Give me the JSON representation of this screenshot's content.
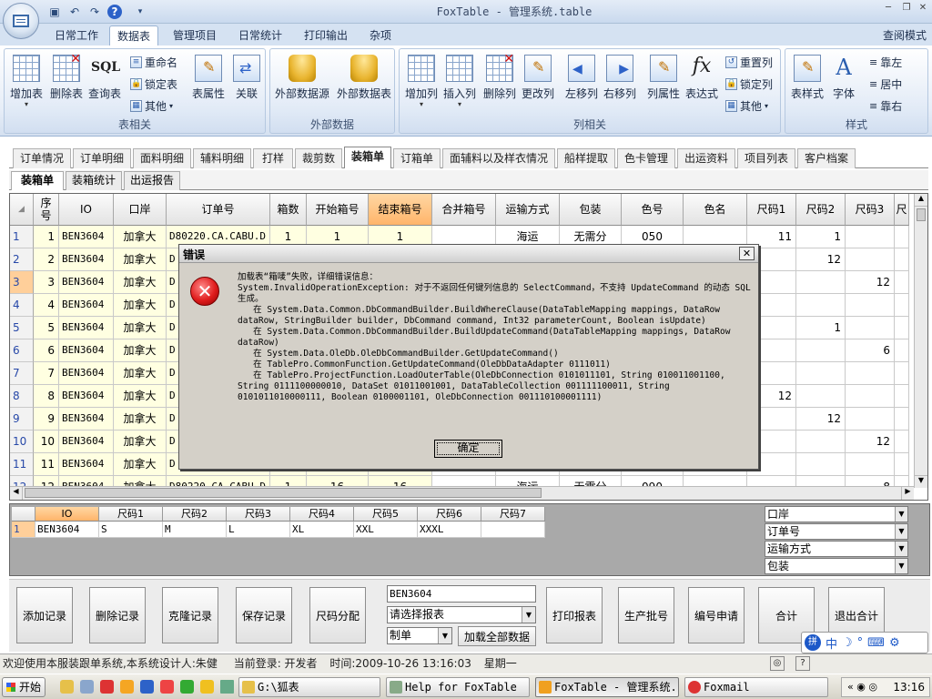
{
  "window": {
    "title": "FoxTable - 管理系统.table"
  },
  "ribbon_tabs": [
    {
      "label": "日常工作",
      "active": false
    },
    {
      "label": "数据表",
      "active": true
    },
    {
      "label": "管理项目",
      "active": false
    },
    {
      "label": "日常统计",
      "active": false
    },
    {
      "label": "打印输出",
      "active": false
    },
    {
      "label": "杂项",
      "active": false
    }
  ],
  "view_mode": "查阅模式",
  "ribbon_groups": {
    "table": {
      "label": "表相关",
      "buttons": [
        "增加表",
        "删除表",
        "查询表"
      ],
      "small": [
        "重命名",
        "锁定表",
        "其他"
      ],
      "extra": [
        "表属性",
        "关联"
      ]
    },
    "external": {
      "label": "外部数据",
      "buttons": [
        "外部数据源",
        "外部数据表"
      ]
    },
    "column": {
      "label": "列相关",
      "buttons": [
        "增加列",
        "插入列",
        "删除列",
        "更改列",
        "左移列",
        "右移列",
        "列属性",
        "表达式"
      ],
      "small": [
        "重置列",
        "锁定列",
        "其他"
      ]
    },
    "style": {
      "label": "样式",
      "buttons": [
        "表样式",
        "字体"
      ],
      "small": [
        "靠左",
        "居中",
        "靠右"
      ]
    },
    "sql_icon": "SQL"
  },
  "main_tabs": [
    {
      "label": "订单情况",
      "active": false
    },
    {
      "label": "订单明细",
      "active": false
    },
    {
      "label": "面料明细",
      "active": false
    },
    {
      "label": "辅料明细",
      "active": false
    },
    {
      "label": "打样",
      "active": false
    },
    {
      "label": "裁剪数",
      "active": false
    },
    {
      "label": "装箱单",
      "active": true
    },
    {
      "label": "订箱单",
      "active": false
    },
    {
      "label": "面辅料以及样衣情况",
      "active": false
    },
    {
      "label": "船样提取",
      "active": false
    },
    {
      "label": "色卡管理",
      "active": false
    },
    {
      "label": "出运资料",
      "active": false
    },
    {
      "label": "项目列表",
      "active": false
    },
    {
      "label": "客户档案",
      "active": false
    }
  ],
  "sub_tabs": [
    {
      "label": "装箱单",
      "active": true
    },
    {
      "label": "装箱统计",
      "active": false
    },
    {
      "label": "出运报告",
      "active": false
    }
  ],
  "grid": {
    "columns": [
      "序\n号",
      "IO",
      "口岸",
      "订单号",
      "箱数",
      "开始箱号",
      "结束箱号",
      "合并箱号",
      "运输方式",
      "包装",
      "色号",
      "色名",
      "尺码1",
      "尺码2",
      "尺码3",
      "尺"
    ],
    "rows": [
      {
        "rn": "1",
        "seq": "1",
        "io": "BEN3604",
        "port": "加拿大",
        "order": "D80220.CA.CABU.D",
        "boxes": "1",
        "start": "1",
        "end": "1",
        "transport": "海运",
        "pack": "无需分",
        "color": "050",
        "s1": "11",
        "s2": "1",
        "s3": ""
      },
      {
        "rn": "2",
        "seq": "2",
        "io": "BEN3604",
        "port": "加拿大",
        "order": "D",
        "s2": "12",
        "s1": "",
        "s3": ""
      },
      {
        "rn": "3",
        "seq": "3",
        "io": "BEN3604",
        "port": "加拿大",
        "order": "D",
        "s1": "",
        "s2": "",
        "s3": "12"
      },
      {
        "rn": "4",
        "seq": "4",
        "io": "BEN3604",
        "port": "加拿大",
        "order": "D",
        "s1": "",
        "s2": "",
        "s3": ""
      },
      {
        "rn": "5",
        "seq": "5",
        "io": "BEN3604",
        "port": "加拿大",
        "order": "D",
        "s1": "",
        "s2": "1",
        "s3": ""
      },
      {
        "rn": "6",
        "seq": "6",
        "io": "BEN3604",
        "port": "加拿大",
        "order": "D",
        "s1": "",
        "s2": "",
        "s3": "6"
      },
      {
        "rn": "7",
        "seq": "7",
        "io": "BEN3604",
        "port": "加拿大",
        "order": "D",
        "s1": "",
        "s2": "",
        "s3": ""
      },
      {
        "rn": "8",
        "seq": "8",
        "io": "BEN3604",
        "port": "加拿大",
        "order": "D",
        "s1": "12",
        "s2": "",
        "s3": ""
      },
      {
        "rn": "9",
        "seq": "9",
        "io": "BEN3604",
        "port": "加拿大",
        "order": "D",
        "s1": "",
        "s2": "12",
        "s3": ""
      },
      {
        "rn": "10",
        "seq": "10",
        "io": "BEN3604",
        "port": "加拿大",
        "order": "D",
        "s1": "",
        "s2": "",
        "s3": "12"
      },
      {
        "rn": "11",
        "seq": "11",
        "io": "BEN3604",
        "port": "加拿大",
        "order": "D",
        "s1": "",
        "s2": "",
        "s3": ""
      },
      {
        "rn": "12",
        "seq": "12",
        "io": "BEN3604",
        "port": "加拿大",
        "order": "D80220.CA.CABU.D",
        "boxes": "1",
        "start": "16",
        "end": "16",
        "transport": "海运",
        "pack": "无需分",
        "color": "090",
        "s1": "",
        "s2": "",
        "s3": "8"
      }
    ],
    "selected_row": "3"
  },
  "dialog": {
    "title": "错误",
    "message": "加载表“箱唛”失败，详细错误信息：\nSystem.InvalidOperationException: 对于不返回任何键列信息的 SelectCommand，不支持 UpdateCommand 的动态 SQL 生成。\n   在 System.Data.Common.DbCommandBuilder.BuildWhereClause(DataTableMapping mappings, DataRow dataRow, StringBuilder builder, DbCommand command, Int32 parameterCount, Boolean isUpdate)\n   在 System.Data.Common.DbCommandBuilder.BuildUpdateCommand(DataTableMapping mappings, DataRow dataRow)\n   在 System.Data.OleDb.OleDbCommandBuilder.GetUpdateCommand()\n   在 TablePro.CommonFunction.GetUpdateCommand(OleDbDataAdapter 0111011)\n   在 TablePro.ProjectFunction.LoadOuterTable(OleDbConnection 0101011101, String 010011001100, String 0111100000010, DataSet 01011001001, DataTableCollection 001111100011, String 0101011010000111, Boolean 0100001101, OleDbConnection 001110100001111)",
    "ok": "确定"
  },
  "sub_grid": {
    "columns": [
      "IO",
      "尺码1",
      "尺码2",
      "尺码3",
      "尺码4",
      "尺码5",
      "尺码6",
      "尺码7"
    ],
    "row": {
      "rn": "1",
      "values": [
        "BEN3604",
        "S",
        "M",
        "L",
        "XL",
        "XXL",
        "XXXL",
        ""
      ]
    }
  },
  "filters": [
    "口岸",
    "订单号",
    "运输方式",
    "包装"
  ],
  "actions": {
    "buttons_left": [
      "添加记录",
      "删除记录",
      "克隆记录",
      "保存记录",
      "尺码分配"
    ],
    "io_input": "BEN3604",
    "report_select": "请选择报表",
    "doc_select": "制单",
    "load_all": "加载全部数据",
    "buttons_right": [
      "打印报表",
      "生产批号",
      "编号申请",
      "合计",
      "退出合计"
    ]
  },
  "ime": "中",
  "status": {
    "welcome": "欢迎使用本服装跟单系统,本系统设计人:朱健",
    "login": "当前登录: 开发者",
    "time": "时间:2009-10-26 13:16:03",
    "weekday": "星期一"
  },
  "taskbar": {
    "start": "开始",
    "tasks": [
      {
        "label": "G:\\狐表",
        "active": false
      },
      {
        "label": "Help for FoxTable",
        "active": false
      },
      {
        "label": "FoxTable - 管理系统...",
        "active": true
      },
      {
        "label": "Foxmail",
        "active": false
      }
    ],
    "clock": "13:16"
  }
}
